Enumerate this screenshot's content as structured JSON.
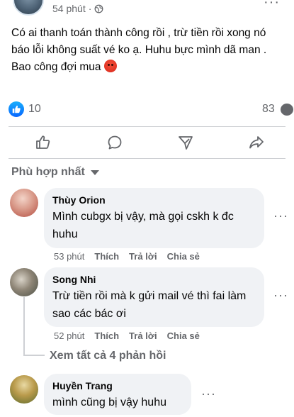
{
  "post": {
    "time": "54 phút",
    "dot": "·",
    "more_label": "···",
    "text": "Có ai thanh toán thành công rồi , trừ tiền rồi xong nó báo lỗi không suất vé ko ạ. Huhu bực mình dã man . Bao công đợi mua",
    "emoji": "angry-face-emoji"
  },
  "stats": {
    "likes": "10",
    "comments": "83"
  },
  "actions": {
    "like": "like-icon",
    "comment": "comment-icon",
    "send": "send-icon",
    "share": "share-icon"
  },
  "sort_label": "Phù hợp nhất",
  "comments": [
    {
      "name": "Thùy Orion",
      "text": "Mình cubgx bị vậy, mà gọi cskh k đc huhu",
      "time": "53 phút",
      "like_label": "Thích",
      "reply_label": "Trả lời",
      "share_label": "Chia sẻ"
    },
    {
      "name": "Song Nhi",
      "text": "Trừ tiền rồi mà k gửi mail vé thì fai làm sao các bác ơi",
      "time": "52 phút",
      "like_label": "Thích",
      "reply_label": "Trả lời",
      "share_label": "Chia sẻ"
    },
    {
      "name": "Huyền Trang",
      "text": "mình cũng bị vậy huhu"
    }
  ],
  "view_replies": "Xem tất cả 4 phản hồi",
  "more_dots": "···",
  "colors": {
    "accent": "#0866ff",
    "secondary_text": "#65676b",
    "bubble": "#f0f2f5"
  }
}
